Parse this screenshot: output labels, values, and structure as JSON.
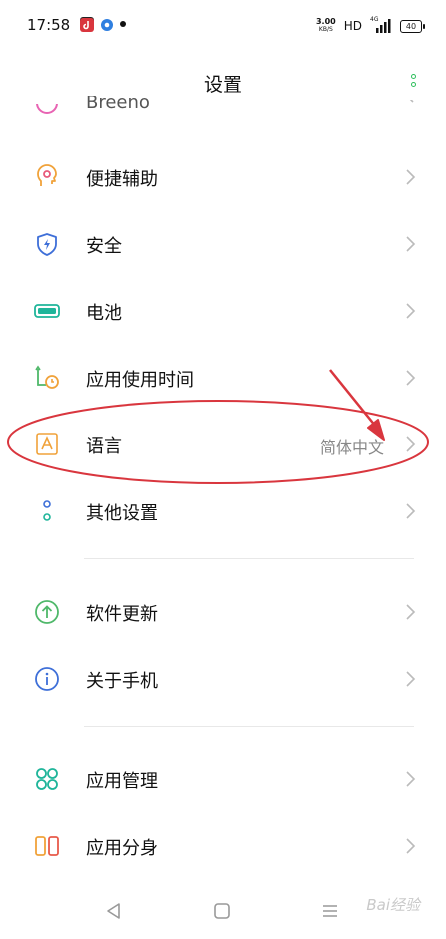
{
  "status_bar": {
    "time": "17:58",
    "net_speed_value": "3.00",
    "net_speed_unit": "KB/S",
    "hd": "HD",
    "signal": "4G",
    "battery": "40"
  },
  "header": {
    "title": "设置"
  },
  "list": {
    "cut_item_label": "Breeno",
    "items": [
      {
        "label": "便捷辅助",
        "icon": "accessibility-icon"
      },
      {
        "label": "安全",
        "icon": "shield-icon"
      },
      {
        "label": "电池",
        "icon": "battery-icon"
      },
      {
        "label": "应用使用时间",
        "icon": "app-usage-time-icon"
      },
      {
        "label": "语言",
        "value": "简体中文",
        "icon": "language-icon"
      },
      {
        "label": "其他设置",
        "icon": "more-settings-icon"
      },
      {
        "label": "软件更新",
        "icon": "software-update-icon"
      },
      {
        "label": "关于手机",
        "icon": "info-icon"
      },
      {
        "label": "应用管理",
        "icon": "app-management-icon"
      },
      {
        "label": "应用分身",
        "icon": "app-clone-icon"
      }
    ]
  },
  "watermark": "Bai经验",
  "colors": {
    "accent_green": "#2dbf5c",
    "annotation_red": "#d9363e",
    "icon_orange": "#f0a23a",
    "icon_blue": "#3e6fd8",
    "icon_teal": "#1fb59a"
  }
}
